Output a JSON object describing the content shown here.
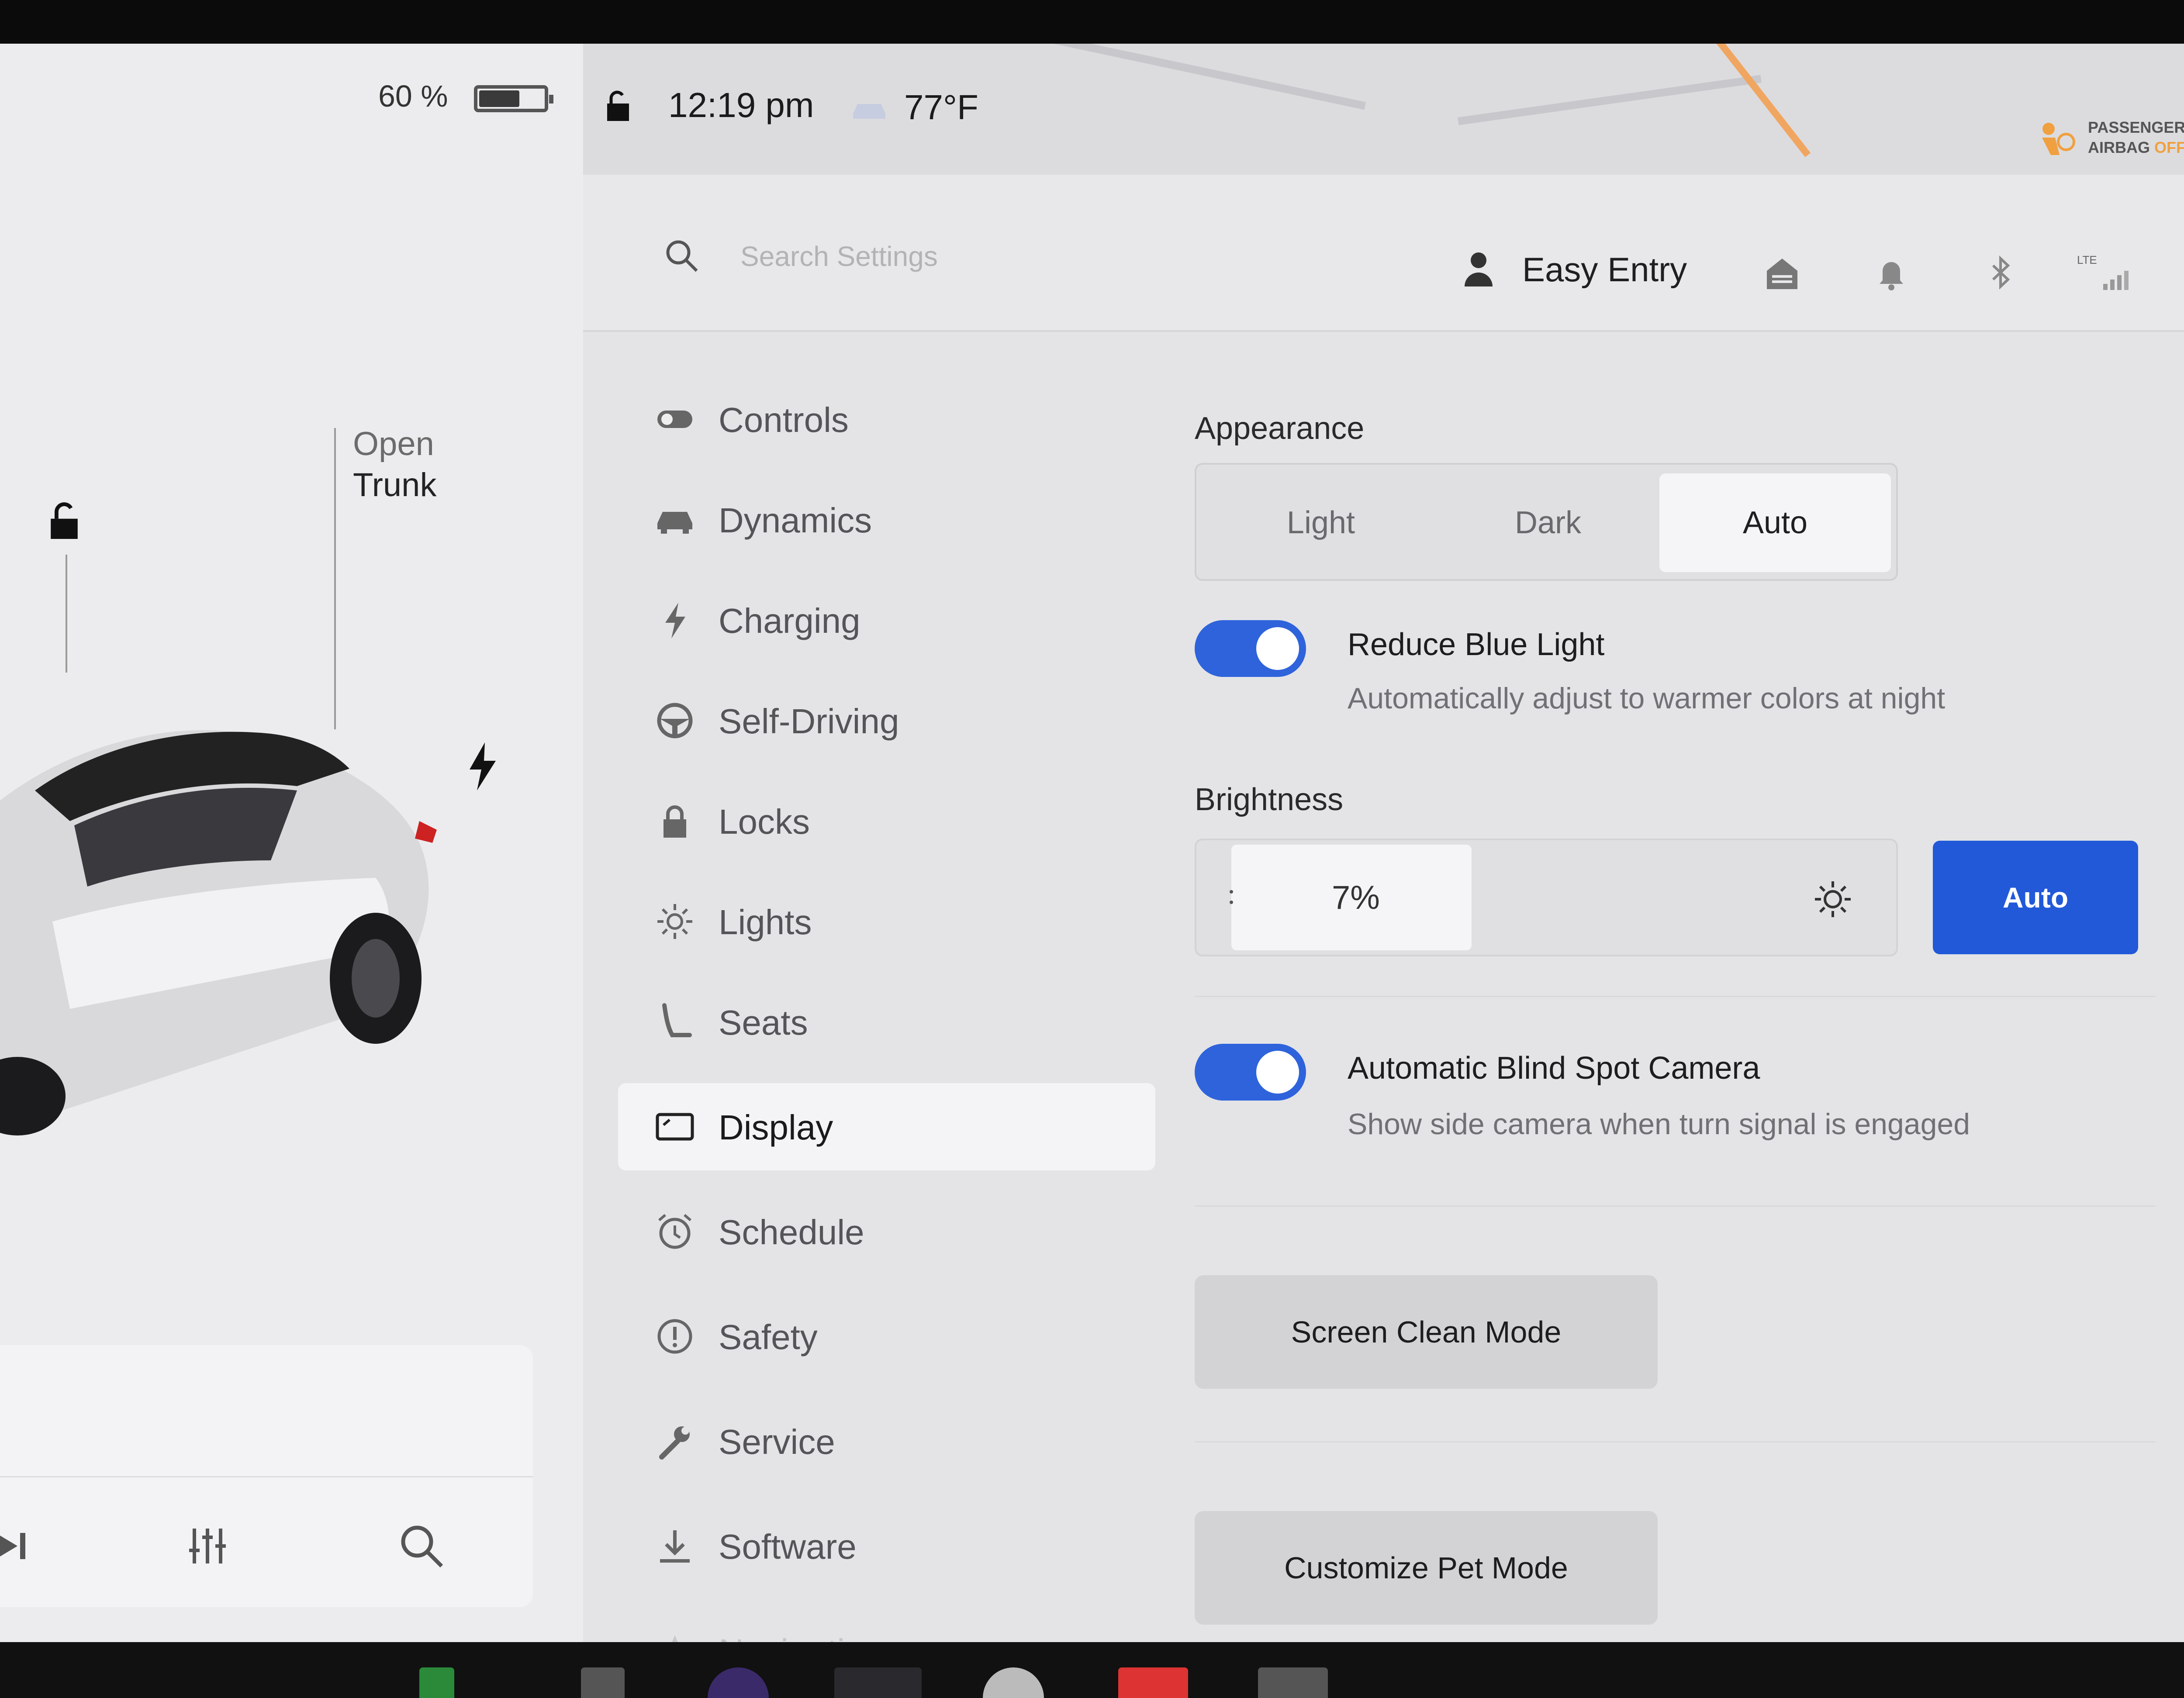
{
  "car_panel": {
    "battery_percent_text": "60 %",
    "battery_level": 0.6,
    "trunk_action_line1": "Open",
    "trunk_action_line2": "Trunk"
  },
  "status_bar": {
    "time": "12:19 pm",
    "temperature": "77°F",
    "airbag_line1": "PASSENGER",
    "airbag_line2": "AIRBAG",
    "airbag_state": "OFF"
  },
  "top_bar": {
    "search_placeholder": "Search Settings",
    "profile_name": "Easy Entry",
    "signal_label": "LTE"
  },
  "sidebar": {
    "items": [
      {
        "label": "Controls",
        "icon": "toggle-icon"
      },
      {
        "label": "Dynamics",
        "icon": "car-icon"
      },
      {
        "label": "Charging",
        "icon": "bolt-icon"
      },
      {
        "label": "Self-Driving",
        "icon": "steering-wheel-icon"
      },
      {
        "label": "Locks",
        "icon": "lock-icon"
      },
      {
        "label": "Lights",
        "icon": "sun-icon"
      },
      {
        "label": "Seats",
        "icon": "seat-icon"
      },
      {
        "label": "Display",
        "icon": "display-icon",
        "active": true
      },
      {
        "label": "Schedule",
        "icon": "alarm-clock-icon"
      },
      {
        "label": "Safety",
        "icon": "alert-circle-icon"
      },
      {
        "label": "Service",
        "icon": "wrench-icon"
      },
      {
        "label": "Software",
        "icon": "download-icon"
      },
      {
        "label": "Navigation",
        "icon": "navigation-arrow-icon"
      }
    ]
  },
  "display": {
    "appearance_title": "Appearance",
    "appearance_options": [
      "Light",
      "Dark",
      "Auto"
    ],
    "appearance_selected": "Auto",
    "reduce_blue_light": {
      "title": "Reduce Blue Light",
      "subtitle": "Automatically adjust to warmer colors at night",
      "enabled": true
    },
    "brightness_title": "Brightness",
    "brightness_value_text": "7%",
    "brightness_auto_label": "Auto",
    "blind_spot": {
      "title": "Automatic Blind Spot Camera",
      "subtitle": "Show side camera when turn signal is engaged",
      "enabled": true
    },
    "screen_clean_label": "Screen Clean Mode",
    "pet_mode_label": "Customize Pet Mode"
  },
  "colors": {
    "accent_blue": "#2159d8",
    "toggle_blue": "#2e63db",
    "airbag_orange": "#f0a040"
  }
}
